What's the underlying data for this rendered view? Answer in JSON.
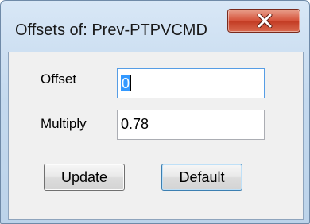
{
  "window": {
    "title": "Offsets of: Prev-PTPVCMD",
    "close_icon": "close-icon"
  },
  "form": {
    "offset_label": "Offset",
    "offset_value": "0",
    "multiply_label": "Multiply",
    "multiply_value": "0.78"
  },
  "buttons": {
    "update_label": "Update",
    "default_label": "Default"
  },
  "colors": {
    "close_button": "#c94a32",
    "selection": "#3399ff",
    "dialog_background": "#f0f0f0"
  }
}
